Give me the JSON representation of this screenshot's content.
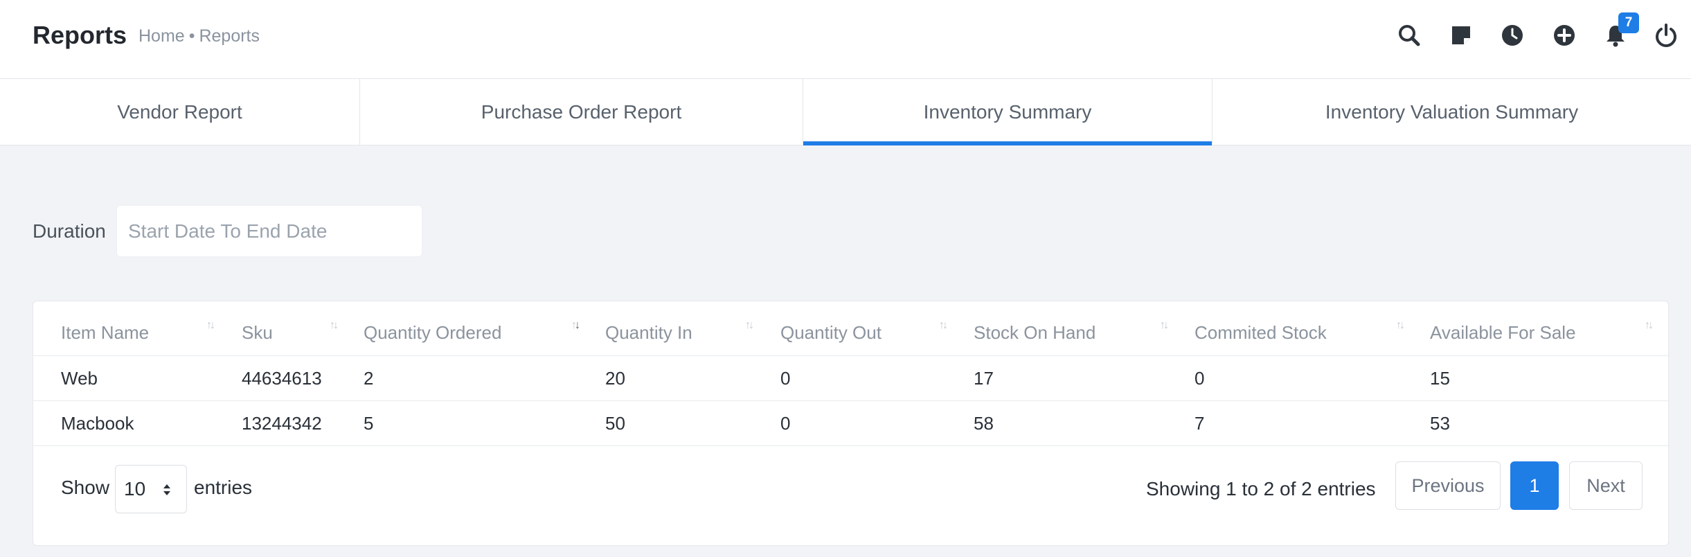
{
  "header": {
    "title": "Reports",
    "breadcrumb": {
      "home": "Home",
      "separator": "•",
      "current": "Reports"
    },
    "notification_count": "7",
    "icons": [
      "search-icon",
      "note-icon",
      "clock-icon",
      "plus-circle-icon",
      "bell-icon",
      "power-icon"
    ]
  },
  "tabs": [
    {
      "label": "Vendor Report",
      "active": false
    },
    {
      "label": "Purchase Order Report",
      "active": false
    },
    {
      "label": "Inventory Summary",
      "active": true
    },
    {
      "label": "Inventory Valuation Summary",
      "active": false
    }
  ],
  "filter": {
    "duration_label": "Duration",
    "duration_placeholder": "Start Date To End Date",
    "duration_value": ""
  },
  "table": {
    "columns": [
      "Item Name",
      "Sku",
      "Quantity Ordered",
      "Quantity In",
      "Quantity Out",
      "Stock On Hand",
      "Commited Stock",
      "Available For Sale"
    ],
    "sorted_column": "Quantity Ordered",
    "rows": [
      [
        "Web",
        "44634613",
        "2",
        "20",
        "0",
        "17",
        "0",
        "15"
      ],
      [
        "Macbook",
        "13244342",
        "5",
        "50",
        "0",
        "58",
        "7",
        "53"
      ]
    ]
  },
  "footer": {
    "show_label": "Show",
    "page_size": "10",
    "entries_label": "entries",
    "info": "Showing 1 to 2 of 2 entries",
    "previous_label": "Previous",
    "current_page": "1",
    "next_label": "Next"
  },
  "colors": {
    "accent": "#1f7de6",
    "background": "#f2f3f6",
    "header_text": "#8b939d"
  }
}
